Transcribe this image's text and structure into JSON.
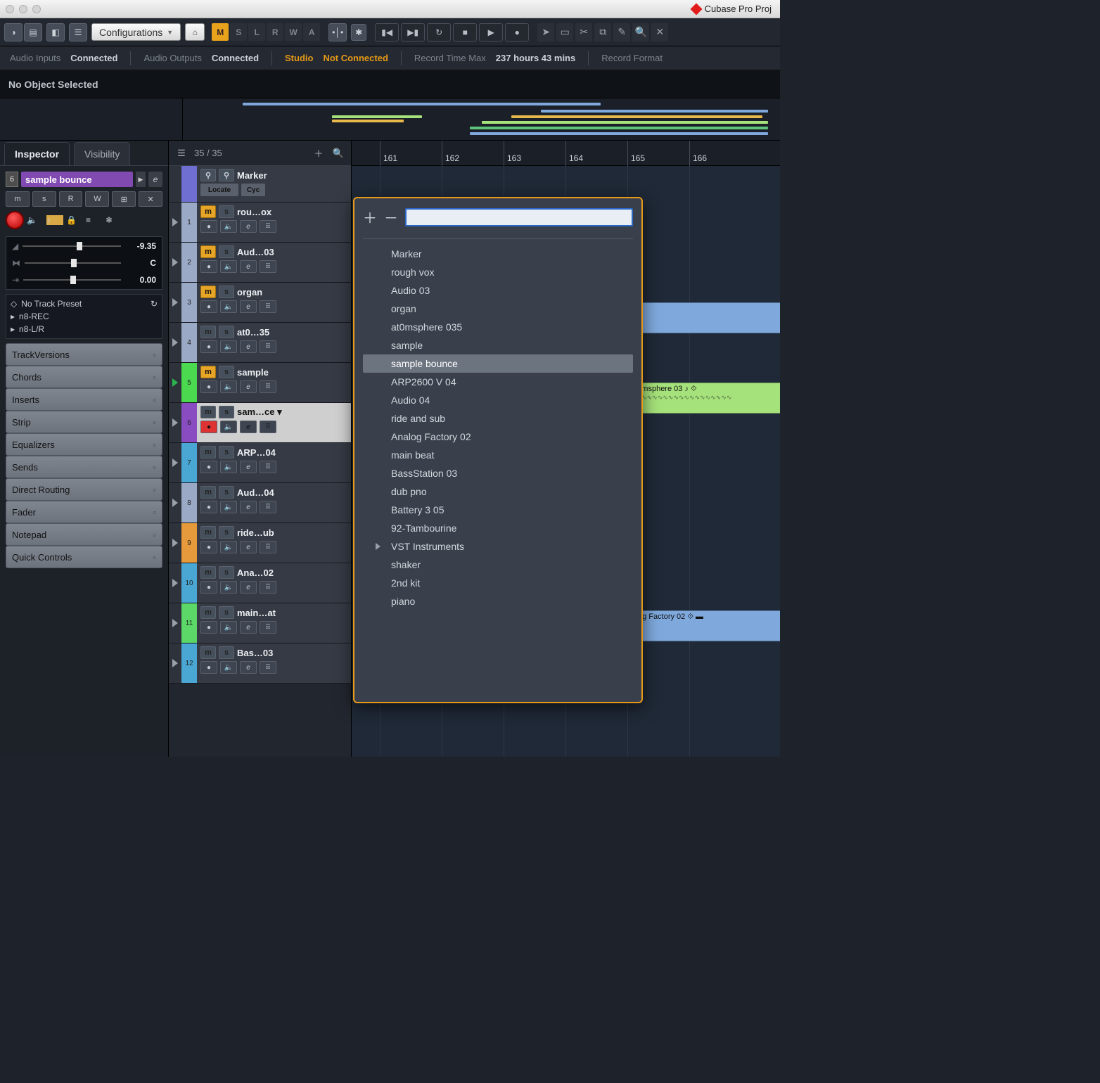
{
  "app_title": "Cubase Pro Proj",
  "toolbar": {
    "config_label": "Configurations",
    "msrwa": [
      "M",
      "S",
      "L",
      "R",
      "W",
      "A"
    ]
  },
  "status": {
    "audio_inputs_label": "Audio Inputs",
    "audio_inputs_value": "Connected",
    "audio_outputs_label": "Audio Outputs",
    "audio_outputs_value": "Connected",
    "studio_label": "Studio",
    "studio_value": "Not Connected",
    "rec_time_label": "Record Time Max",
    "rec_time_value": "237 hours 43 mins",
    "rec_format_label": "Record Format"
  },
  "selection_strip": "No Object Selected",
  "inspector": {
    "tabs": {
      "inspector": "Inspector",
      "visibility": "Visibility"
    },
    "track_number": "6",
    "track_name": "sample bounce",
    "volume": "-9.35",
    "pan_label": "C",
    "delay": "0.00",
    "preset_label": "No Track Preset",
    "routing_in": "n8-REC",
    "routing_out": "n8-L/R",
    "sections": [
      "TrackVersions",
      "Chords",
      "Inserts",
      "Strip",
      "Equalizers",
      "Sends",
      "Direct Routing",
      "Fader",
      "Notepad",
      "Quick Controls"
    ]
  },
  "tracklist": {
    "count": "35 / 35",
    "marker_locate": "Locate",
    "marker_cycle": "Cyc",
    "tracks": [
      {
        "name": "Marker",
        "color": "#6e6fd0",
        "is_marker": true
      },
      {
        "num": "1",
        "name": "rou…ox",
        "color": "#9aa9c5",
        "m": true
      },
      {
        "num": "2",
        "name": "Aud…03",
        "color": "#9aa9c5",
        "m": true
      },
      {
        "num": "3",
        "name": "organ",
        "color": "#9aa9c5",
        "m": true
      },
      {
        "num": "4",
        "name": "at0…35",
        "color": "#9aa9c5",
        "m": false
      },
      {
        "num": "5",
        "name": "sample",
        "color": "#4bd94f",
        "m": true,
        "play_green": true
      },
      {
        "num": "6",
        "name": "sam…ce",
        "color": "#8a4cc1",
        "m": false,
        "selected": true,
        "rec": true
      },
      {
        "num": "7",
        "name": "ARP…04",
        "color": "#4aa7d4",
        "m": false
      },
      {
        "num": "8",
        "name": "Aud…04",
        "color": "#9aa9c5",
        "m": false
      },
      {
        "num": "9",
        "name": "ride…ub",
        "color": "#e69a3c",
        "m": false
      },
      {
        "num": "10",
        "name": "Ana…02",
        "color": "#4aa7d4",
        "m": false
      },
      {
        "num": "11",
        "name": "main…at",
        "color": "#5bd867",
        "m": false
      },
      {
        "num": "12",
        "name": "Bas…03",
        "color": "#4aa7d4",
        "m": false
      }
    ]
  },
  "ruler": [
    "161",
    "162",
    "163",
    "164",
    "165",
    "166"
  ],
  "clips": {
    "atm": "at0msphere 03",
    "af": "Analog Factory 02"
  },
  "search": {
    "placeholder": "",
    "items": [
      {
        "label": "Marker"
      },
      {
        "label": "rough vox"
      },
      {
        "label": "Audio 03"
      },
      {
        "label": "organ"
      },
      {
        "label": "at0msphere 035"
      },
      {
        "label": "sample"
      },
      {
        "label": "sample bounce",
        "selected": true
      },
      {
        "label": "ARP2600 V 04"
      },
      {
        "label": "Audio 04"
      },
      {
        "label": "ride and sub"
      },
      {
        "label": "Analog Factory 02"
      },
      {
        "label": "main beat"
      },
      {
        "label": "BassStation 03"
      },
      {
        "label": "dub pno"
      },
      {
        "label": "Battery 3 05"
      },
      {
        "label": " 92-Tambourine"
      },
      {
        "label": "VST Instruments",
        "has_arrow": true
      },
      {
        "label": "shaker"
      },
      {
        "label": "2nd kit"
      },
      {
        "label": "piano"
      }
    ]
  }
}
